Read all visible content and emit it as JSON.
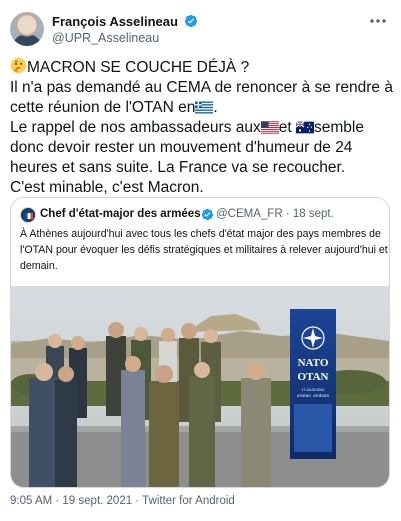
{
  "author": {
    "name": "François Asselineau",
    "handle": "@UPR_Asselineau"
  },
  "tweet_lines": [
    "MACRON SE COUCHE DÉJÀ ?",
    "Il n'a pas demandé au CEMA de renoncer à se rendre à",
    "cette réunion de l'OTAN en",
    "Le rappel de nos ambassadeurs aux",
    "et",
    "semble",
    "donc devoir rester un mouvement d'humeur de 24",
    "heures et sans suite. La France va se recoucher.",
    "C'est minable, c'est Macron."
  ],
  "quoted": {
    "name": "Chef d'état-major des armées",
    "handle": "@CEMA_FR",
    "date": "· 18 sept.",
    "text_lines": [
      "À Athènes aujourd'hui avec tous les chefs d'état major des pays membres de",
      "l'OTAN pour évoquer les défis stratégiques et militaires à relever aujourd'hui et",
      "demain."
    ],
    "photo_banner": {
      "line1": "NATO",
      "line2": "OTAN",
      "small": "17-18.09.2021",
      "small2": "ATHENS · ATHÈNES"
    }
  },
  "footer": "9:05 AM · 19 sept. 2021 · Twitter for Android",
  "icons": [
    "verified-icon",
    "more-icon",
    "thinking-face-emoji",
    "greece-flag-icon",
    "usa-flag-icon",
    "australia-flag-icon",
    "nato-emblem-icon"
  ],
  "colors": {
    "accent": "#1d9bf0",
    "text": "#0f1419",
    "secondary": "#536471",
    "border": "#cfd9de",
    "nato_blue": "#1b3f8b"
  }
}
